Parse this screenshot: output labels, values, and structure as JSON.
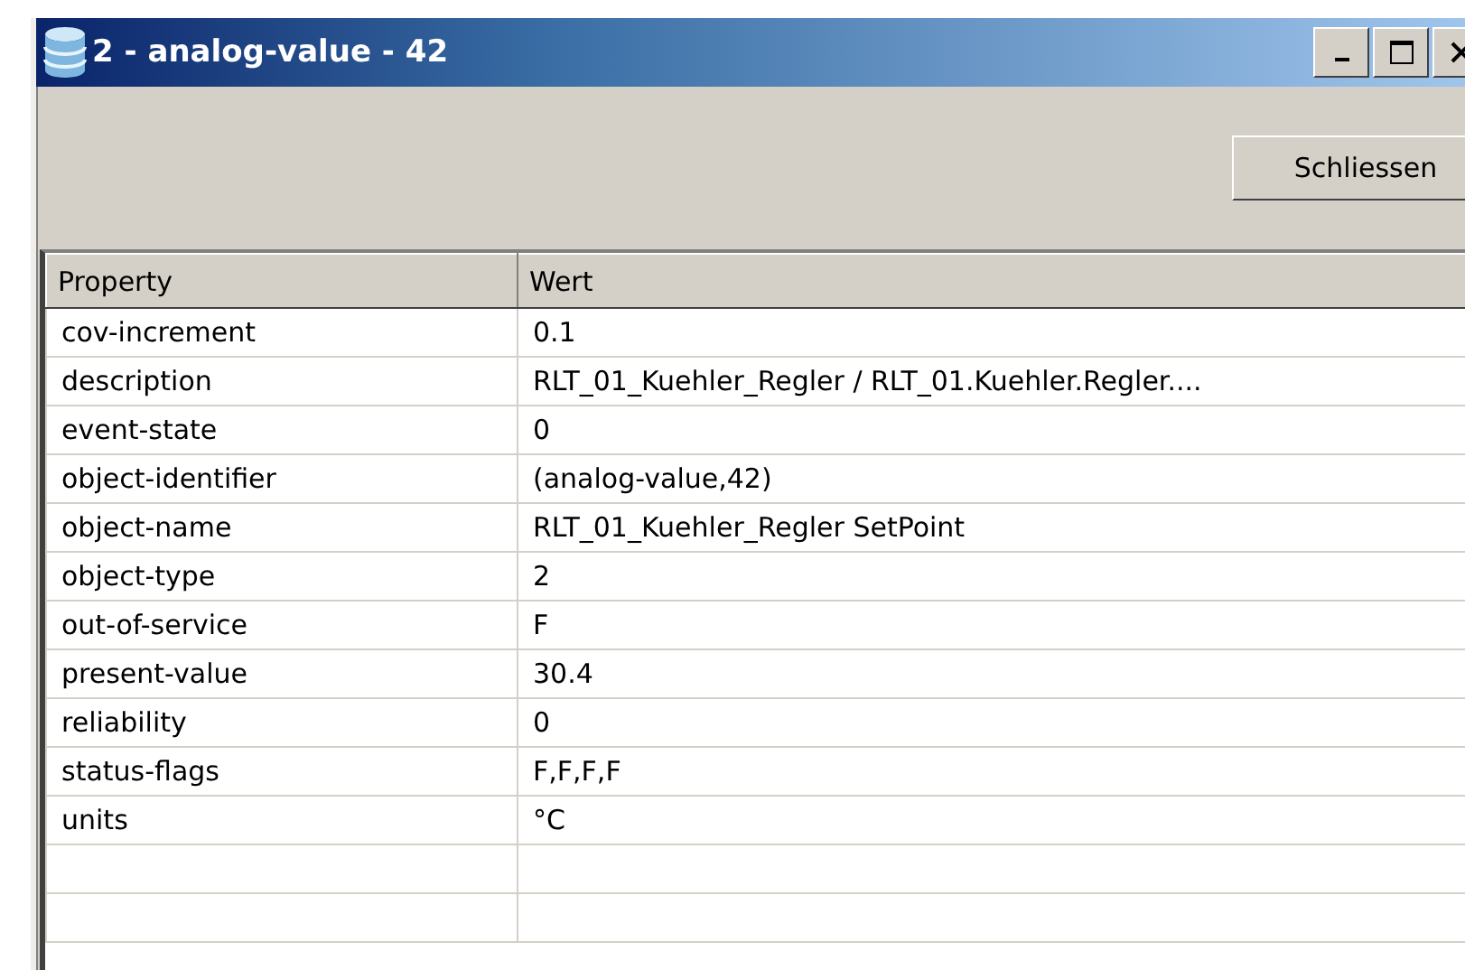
{
  "window": {
    "title": "2 - analog-value - 42"
  },
  "toolbar": {
    "buttons": [
      "Schliessen"
    ]
  },
  "table": {
    "columns": [
      "Property",
      "Wert"
    ],
    "rows": [
      [
        "cov-increment",
        "0.1"
      ],
      [
        "description",
        "RLT_01_Kuehler_Regler / RLT_01.Kuehler.Regler...."
      ],
      [
        "event-state",
        "0"
      ],
      [
        "object-identifier",
        "(analog-value,42)"
      ],
      [
        "object-name",
        "RLT_01_Kuehler_Regler SetPoint"
      ],
      [
        "object-type",
        "2"
      ],
      [
        "out-of-service",
        "F"
      ],
      [
        "present-value",
        "30.4"
      ],
      [
        "reliability",
        "0"
      ],
      [
        "status-flags",
        "F,F,F,F"
      ],
      [
        "units",
        "°C"
      ]
    ]
  }
}
